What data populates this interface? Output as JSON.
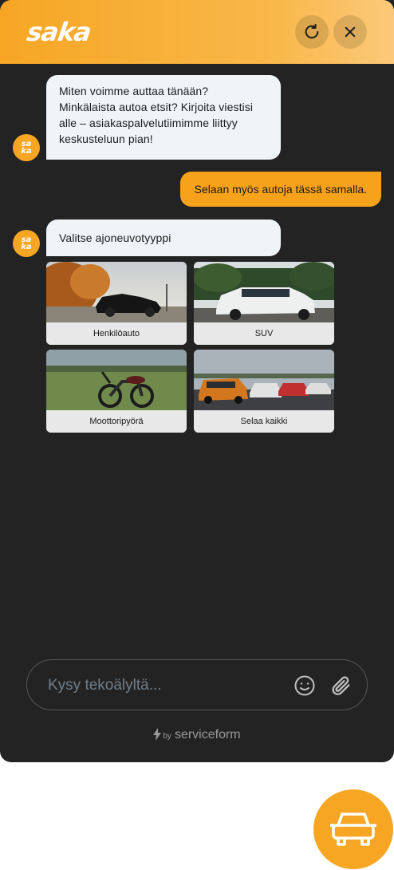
{
  "header": {
    "logo_text": "saka",
    "refresh_icon": "refresh-icon",
    "close_icon": "close-icon"
  },
  "colors": {
    "accent": "#f6a623",
    "background": "#232323",
    "bubble_in": "#eef4f8",
    "bubble_out": "#f7a21b"
  },
  "messages": [
    {
      "from": "bot",
      "text": "Miten voimme auttaa tänään? Minkälaista autoa etsit? Kirjoita viestisi alle – asiakaspalvelutiimimme liittyy keskusteluun pian!"
    },
    {
      "from": "user",
      "text": "Selaan myös autoja tässä samalla."
    },
    {
      "from": "bot",
      "text": "Valitse ajoneuvotyyppi"
    }
  ],
  "avatar_text": "sa ka",
  "vehicle_options": [
    {
      "label": "Henkilöauto"
    },
    {
      "label": "SUV"
    },
    {
      "label": "Moottoripyörä"
    },
    {
      "label": "Selaa kaikki"
    }
  ],
  "input": {
    "placeholder": "Kysy tekoälyltä...",
    "value": ""
  },
  "footer": {
    "by": "by",
    "brand": "serviceform"
  },
  "launcher_icon": "car-icon"
}
